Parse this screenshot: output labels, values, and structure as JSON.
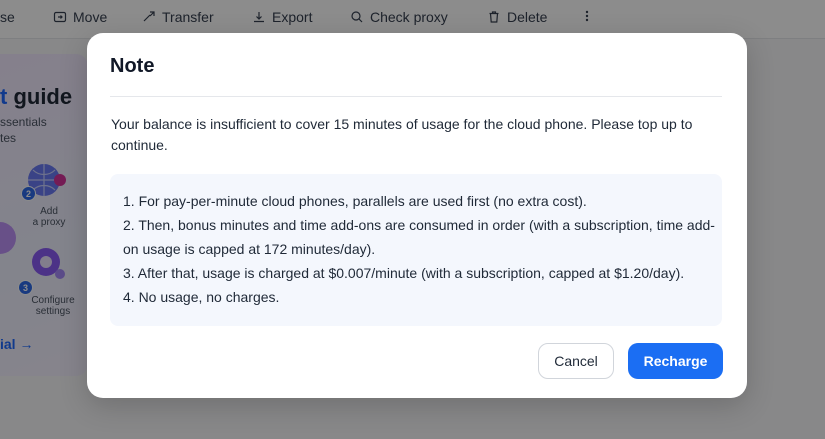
{
  "toolbar": {
    "items": [
      {
        "label": "se",
        "icon": "none"
      },
      {
        "label": "Move",
        "icon": "move-icon"
      },
      {
        "label": "Transfer",
        "icon": "transfer-icon"
      },
      {
        "label": "Export",
        "icon": "export-icon"
      },
      {
        "label": "Check proxy",
        "icon": "check-proxy-icon"
      },
      {
        "label": "Delete",
        "icon": "trash-icon"
      },
      {
        "label": "",
        "icon": "more-vertical-icon"
      }
    ]
  },
  "guide": {
    "title_accent": "t",
    "title_rest": " guide",
    "subtitle_1": "ssentials",
    "subtitle_2": "tes",
    "steps": [
      {
        "number": "2",
        "label_1": "Add",
        "label_2": "a proxy"
      },
      {
        "number": "3",
        "label_1": "Configure",
        "label_2": "settings"
      }
    ],
    "link_label": "ial →"
  },
  "modal": {
    "title": "Note",
    "message": "Your balance is insufficient to cover 15 minutes of usage for the cloud phone. Please top up to continue.",
    "info_lines": [
      "1. For pay-per-minute cloud phones, parallels are used first (no extra cost).",
      "2. Then, bonus minutes and time add-ons are consumed in order (with a subscription, time add-on usage is capped at 172 minutes/day).",
      "3. After that, usage is charged at $0.007/minute (with a subscription, capped at $1.20/day).",
      "4. No usage, no charges."
    ],
    "cancel_label": "Cancel",
    "recharge_label": "Recharge"
  },
  "colors": {
    "primary": "#1b6ef3",
    "info_bg": "#f4f7fd",
    "overlay": "rgba(0,0,0,0.45)"
  }
}
